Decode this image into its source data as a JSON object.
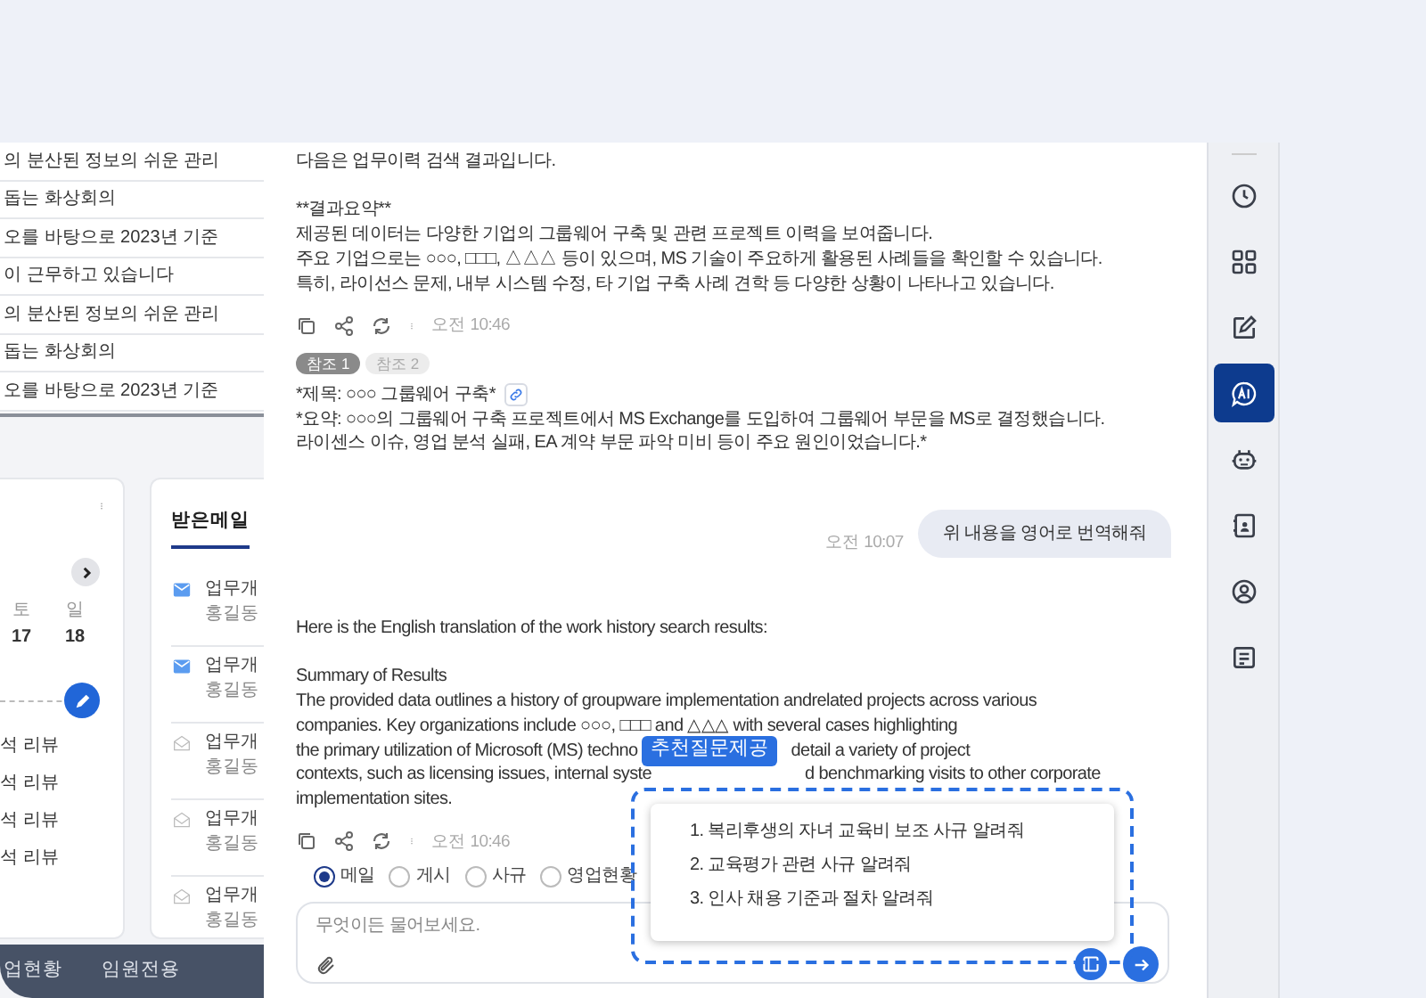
{
  "background_list": {
    "items": [
      "의 분산된 정보의 쉬운 관리",
      "돕는 화상회의",
      "오를 바탕으로 2023년 기준",
      "이 근무하고 있습니다",
      "의 분산된 정보의 쉬운 관리",
      "돕는 화상회의",
      "오를 바탕으로 2023년 기준"
    ]
  },
  "calendar_card": {
    "weekdays": [
      "토",
      "일"
    ],
    "dates": [
      "17",
      "18"
    ],
    "events": [
      "석 리뷰",
      "석 리뷰",
      "석 리뷰",
      "석 리뷰"
    ]
  },
  "mail_card": {
    "tab": "받은메일",
    "items": [
      {
        "subject": "업무개",
        "sender": "홍길동",
        "unread": true
      },
      {
        "subject": "업무개",
        "sender": "홍길동",
        "unread": true
      },
      {
        "subject": "업무개",
        "sender": "홍길동",
        "unread": false
      },
      {
        "subject": "업무개",
        "sender": "홍길동",
        "unread": false
      },
      {
        "subject": "업무개",
        "sender": "홍길동",
        "unread": false
      }
    ]
  },
  "bottom_nav": [
    "업현황",
    "임원전용"
  ],
  "chat": {
    "messages": [
      {
        "kind": "bot",
        "blocks": [
          [
            [
              "다음은 업무이력 검색 결과입니다."
            ]
          ],
          [
            [
              "**결과요약**"
            ],
            [
              "제공된 데이터는 다양한 기업의 그룹웨어 구축 및 관련 프로젝트 이력을 보여줍니다."
            ],
            [
              "주요 기업으로는 ○○○, □□□, △△△ 등이 있으며, MS 기술이 주요하게 활용된 사례들을 확인할 수 있습니다."
            ],
            [
              "특히, 라이선스 문제, 내부 시스템 수정, 타 기업 구축 사례 견학 등 다양한 상황이 나타나고 있습니다."
            ]
          ]
        ],
        "time": "오전 10:46",
        "references": {
          "chips": [
            {
              "label": "참조 1",
              "selected": true
            },
            {
              "label": "참조 2",
              "selected": false
            }
          ],
          "title": "*제목: ○○○ 그룹웨어 구축*",
          "lines": [
            "*요약: ○○○의 그룹웨어 구축 프로젝트에서 MS Exchange를 도입하여 그룹웨어 부문을 MS로 결정했습니다.",
            "라이센스 이슈, 영업 분석 실패, EA 계약 부문 파악 미비 등이 주요 원인이었습니다.*"
          ]
        }
      },
      {
        "kind": "user",
        "text": "위 내용을 영어로 번역해줘",
        "time": "오전 10:07"
      },
      {
        "kind": "bot",
        "blocks": [
          [
            [
              "Here is the English translation of the work history search results:"
            ]
          ],
          [
            [
              "Summary of Results"
            ],
            [
              "The provided data outlines a history of groupware implementation andrelated projects across various"
            ],
            [
              "companies. Key organizations include ○○○, □□□  and △△△ with several cases highlighting"
            ],
            [
              "the primary utilization of Microsoft (MS) techno",
              "detail a variety of project"
            ],
            [
              "contexts, such as licensing issues, internal syste",
              "d benchmarking visits to other corporate"
            ],
            [
              "implementation sites."
            ]
          ]
        ],
        "time": "오전 10:46"
      }
    ],
    "sources": [
      {
        "label": "메일",
        "selected": true
      },
      {
        "label": "게시",
        "selected": false
      },
      {
        "label": "사규",
        "selected": false
      },
      {
        "label": "영업현황",
        "selected": false
      }
    ],
    "input": {
      "placeholder": "무엇이든 물어보세요."
    }
  },
  "suggestions": {
    "label": "추천질문제공",
    "items": [
      "1. 복리후생의 자녀 교육비 보조 사규 알려줘",
      "2. 교육평가 관련 사규 알려줘",
      "3. 인사 채용 기준과 절차 알려줘"
    ]
  },
  "rail": {
    "items": [
      {
        "selected": false
      },
      {
        "selected": false
      },
      {
        "selected": false
      },
      {
        "selected": true
      },
      {
        "selected": false
      },
      {
        "selected": false
      },
      {
        "selected": false
      },
      {
        "selected": false
      }
    ]
  }
}
